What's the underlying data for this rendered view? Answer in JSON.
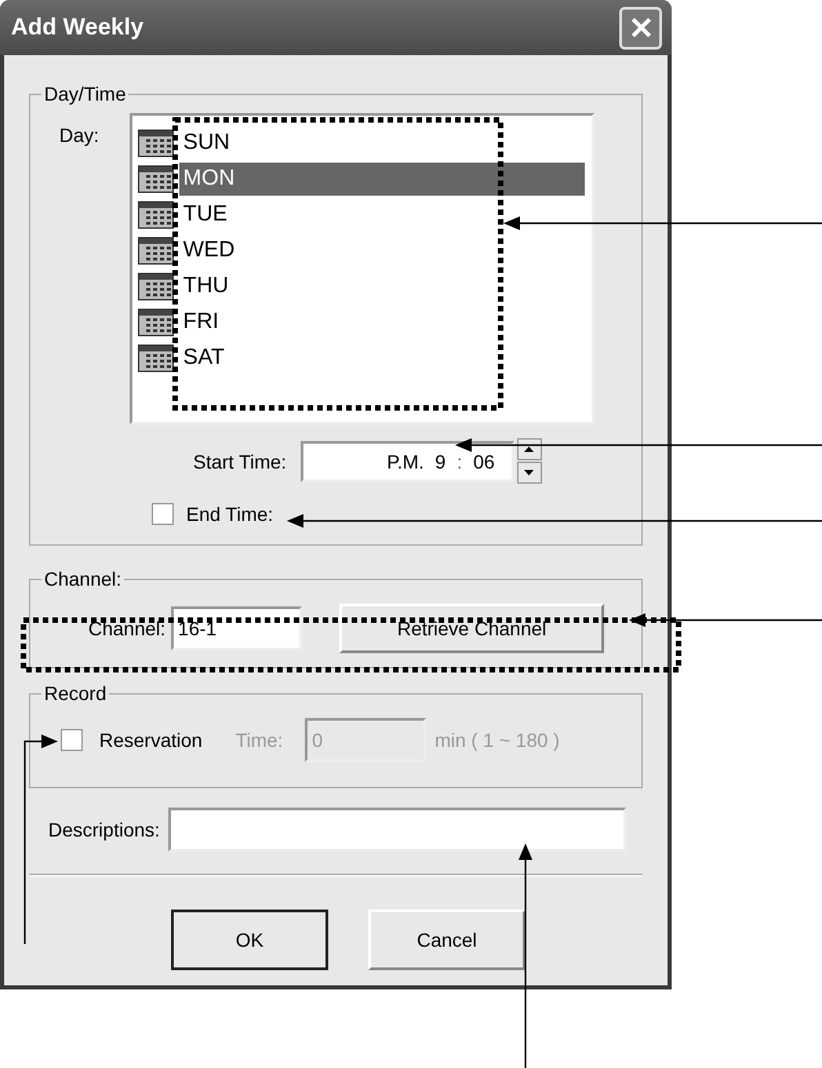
{
  "window": {
    "title": "Add Weekly"
  },
  "day_time": {
    "title": "Day/Time",
    "day_label": "Day:",
    "days": [
      {
        "label": "SUN",
        "selected": false
      },
      {
        "label": "MON",
        "selected": true
      },
      {
        "label": "TUE",
        "selected": false
      },
      {
        "label": "WED",
        "selected": false
      },
      {
        "label": "THU",
        "selected": false
      },
      {
        "label": "FRI",
        "selected": false
      },
      {
        "label": "SAT",
        "selected": false
      }
    ],
    "start_time": {
      "label": "Start Time:",
      "ampm": "P.M.",
      "hour": "9",
      "separator": ":",
      "minute": "06"
    },
    "end_time": {
      "label": "End Time:",
      "checked": false
    }
  },
  "channel": {
    "title": "Channel:",
    "label": "Channel:",
    "value": "16-1",
    "button": "Retrieve Channel"
  },
  "record": {
    "title": "Record",
    "reservation": {
      "label": "Reservation",
      "checked": false
    },
    "time": {
      "label": "Time:",
      "value": "0",
      "disabled": true,
      "range": "min ( 1 ~ 180 )"
    }
  },
  "descriptions": {
    "label": "Descriptions:"
  },
  "buttons": [
    {
      "label": "OK",
      "default": true
    },
    {
      "label": "Cancel",
      "default": false
    }
  ]
}
